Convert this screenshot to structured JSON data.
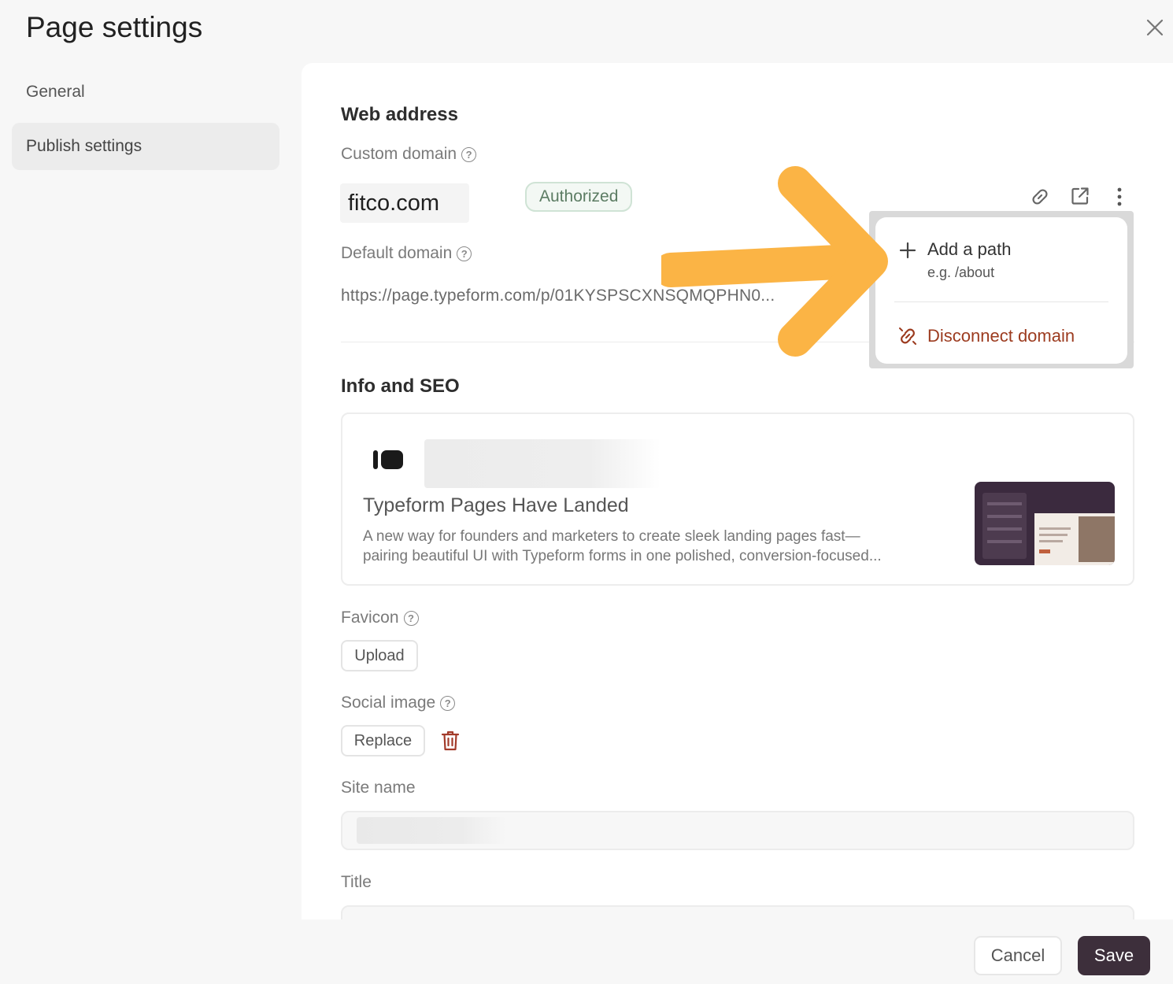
{
  "window": {
    "title": "Page settings",
    "close_icon": "close-icon"
  },
  "sidebar": {
    "items": [
      {
        "label": "General",
        "active": false
      },
      {
        "label": "Publish settings",
        "active": true
      }
    ]
  },
  "web_address": {
    "section_title": "Web address",
    "custom_domain_label": "Custom domain",
    "custom_domain_value": "fitco.com",
    "status_badge": "Authorized",
    "default_domain_label": "Default domain",
    "default_domain_value": "https://page.typeform.com/p/01KYSPSCXNSQMQPHN0..."
  },
  "domain_menu": {
    "add_path_label": "Add a path",
    "add_path_hint": "e.g. /about",
    "disconnect_label": "Disconnect domain"
  },
  "info_seo": {
    "section_title": "Info and SEO",
    "preview_title": "Typeform Pages Have Landed",
    "preview_description_line1": "A new way for founders and marketers to create sleek landing pages fast—",
    "preview_description_line2": "pairing beautiful UI with Typeform forms in one polished, conversion-focused..."
  },
  "favicon": {
    "label": "Favicon",
    "upload_label": "Upload"
  },
  "social_image": {
    "label": "Social image",
    "replace_label": "Replace"
  },
  "site_name": {
    "label": "Site name"
  },
  "title_field": {
    "label": "Title"
  },
  "footer": {
    "cancel_label": "Cancel",
    "save_label": "Save"
  },
  "colors": {
    "save_button": "#3d2f3b",
    "disconnect_text": "#9c3b1f",
    "annotation_arrow": "#fbb445",
    "badge_text": "#5c7c63"
  }
}
